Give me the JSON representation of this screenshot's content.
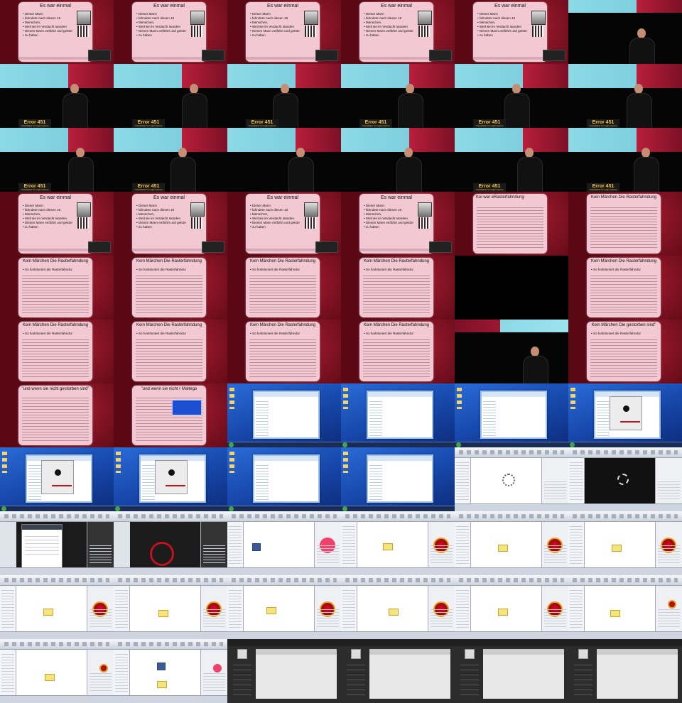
{
  "slides": {
    "es_war_einmal": {
      "title": "Es war einmal",
      "bullets": [
        "Dieser Mann",
        "fahndete nach diesen 16",
        "Menschen,",
        "Weil sie im Verdacht standen",
        "Diesen Mann entführt und getötet",
        "zu haben"
      ]
    },
    "kein_maerchen": {
      "title": "Kein Märchen  Die Rasterfahndung",
      "bullet": "So funktioniert die Rasterfahndung"
    },
    "transition_title": "Kein Märchen  Die Rasterfahndung",
    "transition_partial": "Kei   war eRasterfahndung",
    "gestorben": {
      "title": "\"und wenn sie nicht gestorben sind\"",
      "title_short": "\"und wenn sie nicht r Maltego",
      "title_partial": "Kein Märchen  Die   gestorben sind\""
    }
  },
  "stage": {
    "podium_label": "Error 451",
    "podium_sub": "Unavailable for legal reasons"
  }
}
